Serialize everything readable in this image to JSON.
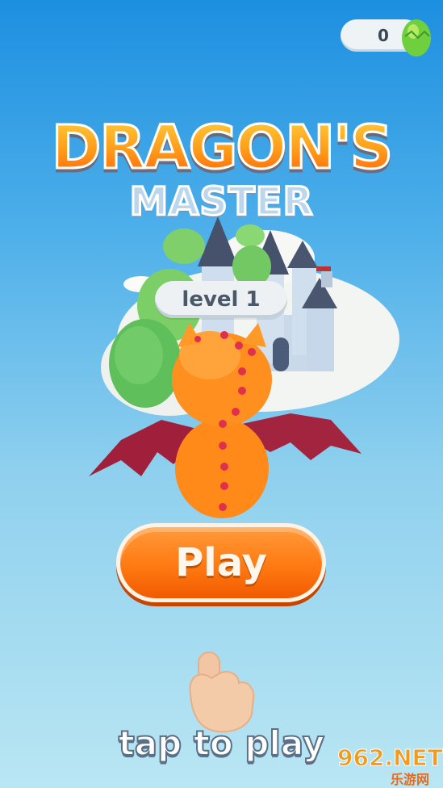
{
  "hud": {
    "egg_count": "0",
    "egg_icon": "green-egg-icon"
  },
  "title": {
    "line1": "DRAGON'S",
    "line2": "MASTER"
  },
  "level": {
    "label": "level 1"
  },
  "play_button": {
    "label": "Play"
  },
  "hint": {
    "text": "tap to play",
    "icon": "pointing-hand-icon"
  },
  "watermark": {
    "top": "962.NET",
    "bottom": "乐游网"
  },
  "colors": {
    "sky_top": "#1d8fe0",
    "sky_bottom": "#b9e6f3",
    "accent_orange": "#ff7a12",
    "egg_green": "#7bd64a"
  }
}
